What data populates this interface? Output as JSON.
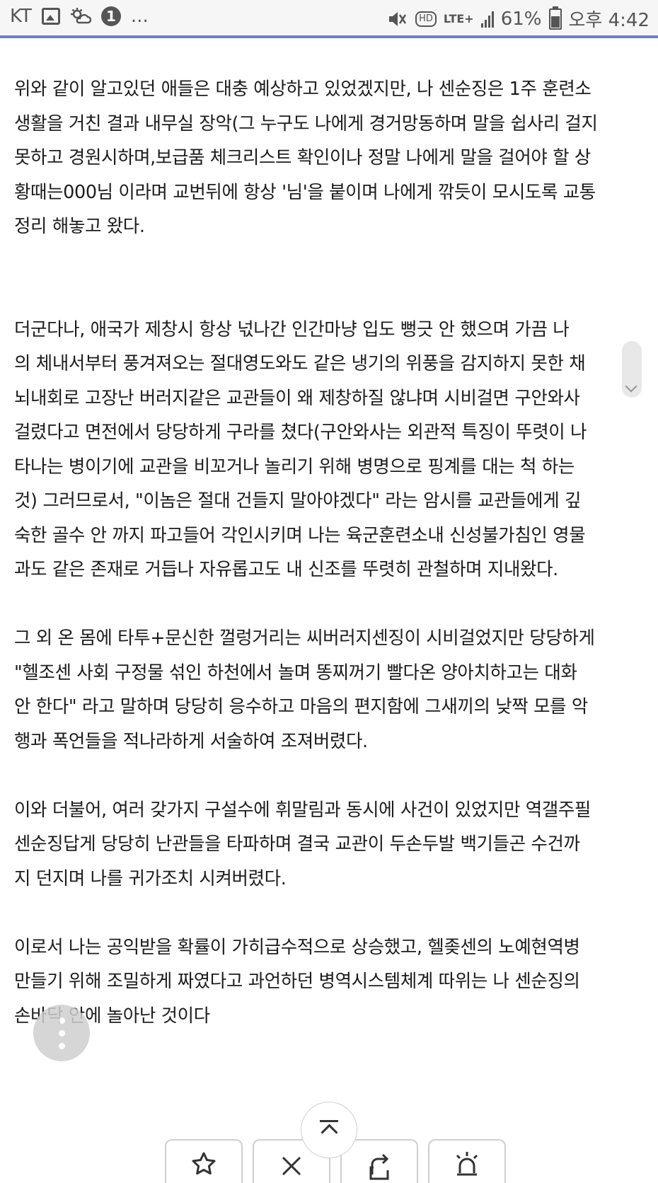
{
  "status_bar": {
    "carrier": "KT",
    "notification_count": "1",
    "more": "...",
    "network": "LTE+",
    "battery": "61%",
    "time": "오후 4:42",
    "icons": [
      "gallery-icon",
      "weather-icon",
      "mute-icon",
      "hd-voice-icon",
      "lte-icon",
      "signal-icon",
      "battery-icon"
    ]
  },
  "article": {
    "paragraphs": [
      "위와 같이 알고있던 애들은 대충 예상하고 있었겠지만, 나 센순징은 1주 훈련소\n생활을 거친 결과 내무실 장악(그 누구도 나에게 경거망동하며 말을 쉽사리 걸지\n못하고 경원시하며,보급품 체크리스트 확인이나 정말 나에게 말을 걸어야 할 상\n황때는000님 이라며 교번뒤에 항상 '님'을 붙이며 나에게 깎듯이 모시도록 교통\n정리 해놓고 왔다.",
      "더군다나, 애국가 제창시 항상 넋나간 인간마냥 입도 뻥긋 안 했으며 가끔 나\n의 체내서부터 풍겨져오는 절대영도와도 같은 냉기의 위풍을 감지하지 못한 채\n뇌내회로 고장난 버러지같은 교관들이 왜 제창하질 않냐며 시비걸면 구안와사\n걸렸다고 면전에서 당당하게 구라를 쳤다(구안와사는 외관적 특징이 뚜렷이 나\n타나는 병이기에 교관을 비꼬거나 놀리기 위해 병명으로 핑계를 대는 척 하는\n것) 그러므로서, \"이놈은 절대 건들지 말아야겠다\" 라는 암시를 교관들에게 깊\n숙한 골수 안 까지 파고들어 각인시키며 나는 육군훈련소내 신성불가침인 영물\n과도 같은 존재로 거듭나 자유롭고도 내 신조를 뚜렷히 관철하며 지내왔다.",
      "그 외 온 몸에 타투+문신한 껄렁거리는 씨버러지센징이 시비걸었지만 당당하게\n\"헬조센 사회 구정물 섞인 하천에서 놀며 똥찌꺼기 빨다온 양아치하고는 대화\n안 한다\" 라고 말하며 당당히 응수하고 마음의 편지함에 그새끼의 낮짝 모를 악\n행과 폭언들을 적나라하게 서술하여 조져버렸다.",
      "이와 더불어, 여러 갖가지 구설수에 휘말림과 동시에 사건이 있었지만 역갤주필\n센순징답게 당당히 난관들을 타파하며 결국 교관이 두손두발 백기들곤 수건까\n지 던지며 나를 귀가조치 시켜버렸다.",
      "이로서 나는 공익받을 확률이 가히급수적으로 상승했고, 헬좆센의 노예현역병\n만들기 위해 조밀하게 짜였다고 과언하던 병역시스템체계 따위는 나 센순징의\n손바닥 안에 놀아난 것이다"
    ]
  },
  "controls": {
    "floating_menu": "more-vertical-icon",
    "scroll_top": "double-chevron-up-icon",
    "bottom_buttons": [
      "star-icon",
      "close-icon",
      "share-icon",
      "siren-icon"
    ]
  },
  "colors": {
    "accent": "#6d7fcf",
    "status_bg": "#f6f6f6",
    "text": "#1c1c1c"
  }
}
